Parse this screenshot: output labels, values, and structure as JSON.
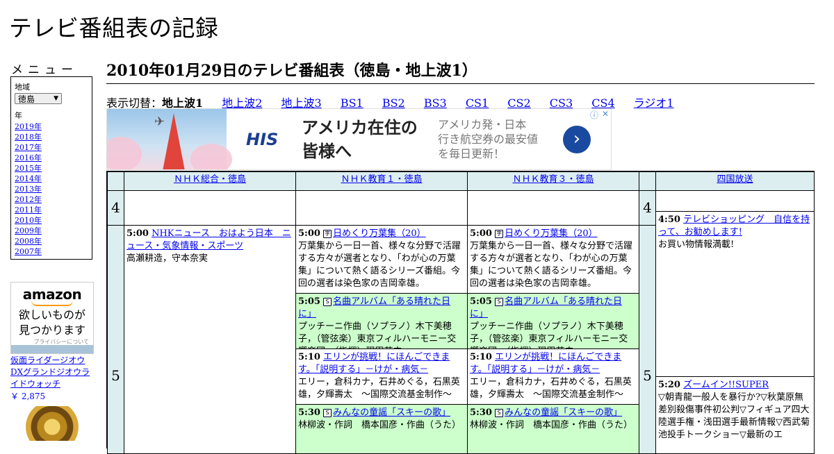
{
  "site_title": "テレビ番組表の記録",
  "sidebar": {
    "menu_heading": "メニュー",
    "region_label": "地域",
    "region_value": "徳島",
    "year_label": "年",
    "years": [
      "2019年",
      "2018年",
      "2017年",
      "2016年",
      "2015年",
      "2014年",
      "2013年",
      "2012年",
      "2011年",
      "2010年",
      "2009年",
      "2008年",
      "2007年"
    ],
    "ad": {
      "logo": "amazon",
      "tagline_1": "欲しいものが",
      "tagline_2": "見つかります",
      "privacy": "プライバシーについて"
    },
    "product": {
      "name": "仮面ライダージオウ DXグランドジオウライドウォッチ",
      "price": "￥ 2,875"
    }
  },
  "main": {
    "title": "2010年01月29日のテレビ番組表（徳島・地上波1）",
    "switch_label": "表示切替：",
    "switch_current": "地上波1",
    "switch_links": [
      "地上波2",
      "地上波3",
      "BS1",
      "BS2",
      "BS3",
      "CS1",
      "CS2",
      "CS3",
      "CS4",
      "ラジオ1"
    ],
    "banner": {
      "brand": "HIS",
      "headline_1": "アメリカ在住の",
      "headline_2": "皆様へ",
      "sub_1": "アメリカ発・日本",
      "sub_2": "行き航空券の最安値",
      "sub_3": "を毎日更新！",
      "go": "›",
      "info": "ⓘ",
      "close": "✕"
    },
    "channels": [
      "ＮＨＫ総合・徳島",
      "ＮＨＫ教育１・徳島",
      "ＮＨＫ教育３・徳島",
      "四国放送"
    ],
    "hours": [
      "4",
      "5"
    ],
    "programs": {
      "nhk_sogo_500": {
        "time": "5:00",
        "title": "NHKニュース　おはよう日本　ニュース・気象情報・スポーツ",
        "desc": "高瀬耕造，守本奈実"
      },
      "edu1_500": {
        "time": "5:00",
        "badge": "字",
        "title": "日めくり万葉集（20）",
        "desc": "万葉集から一日一首、様々な分野で活躍する方々が選者となり、「わが心の万葉集」について熱く語るシリーズ番組。今回の選者は染色家の吉岡幸雄。"
      },
      "edu1_505": {
        "time": "5:05",
        "badge": "S",
        "title": "名曲アルバム「ある晴れた日に」",
        "desc": "プッチーニ作曲（ソプラノ）木下美穂子，（管弦楽）東京フィルハーモニー交響楽団，（指揮）現田茂夫"
      },
      "edu1_510": {
        "time": "5:10",
        "title": "エリンが挑戦！にほんごできます。「説明する」－けが・病気－",
        "desc": "エリー，倉科カナ，石井めぐる，石黒英雄，夕輝壽太　～国際交流基金制作～"
      },
      "edu1_530": {
        "time": "5:30",
        "badge": "S",
        "title": "みんなの童謡「スキーの歌」",
        "desc": "林柳波・作詞　橋本国彦・作曲（うた）"
      },
      "edu3_500": {
        "time": "5:00",
        "badge": "字",
        "title": "日めくり万葉集（20）",
        "desc": "万葉集から一日一首、様々な分野で活躍する方々が選者となり、「わが心の万葉集」について熱く語るシリーズ番組。今回の選者は染色家の吉岡幸雄。"
      },
      "edu3_505": {
        "time": "5:05",
        "badge": "S",
        "title": "名曲アルバム「ある晴れた日に」",
        "desc": "プッチーニ作曲（ソプラノ）木下美穂子，（管弦楽）東京フィルハーモニー交響楽団，（指揮）現田茂夫"
      },
      "edu3_510": {
        "time": "5:10",
        "title": "エリンが挑戦！にほんごできます。「説明する」－けが・病気－",
        "desc": "エリー，倉科カナ，石井めぐる，石黒英雄，夕輝壽太　～国際交流基金制作～"
      },
      "edu3_530": {
        "time": "5:30",
        "badge": "S",
        "title": "みんなの童謡「スキーの歌」",
        "desc": "林柳波・作詞　橋本国彦・作曲（うた）"
      },
      "shikoku_450": {
        "time": "4:50",
        "title": "テレビショッピング　自信を持って、お勧めします!",
        "desc": "お買い物情報満載!"
      },
      "shikoku_520": {
        "time": "5:20",
        "title": "ズームイン!!SUPER",
        "desc": "▽朝青龍一般人を暴行か?▽秋葉原無差別殺傷事件初公判▽フィギュア四大陸選手権・浅田選手最新情報▽西武菊池投手トークショー▽最新のエ"
      }
    }
  },
  "colors": {
    "header_bg": "#dceef0",
    "green_cell": "#ccffcc",
    "link": "#0000ee"
  }
}
